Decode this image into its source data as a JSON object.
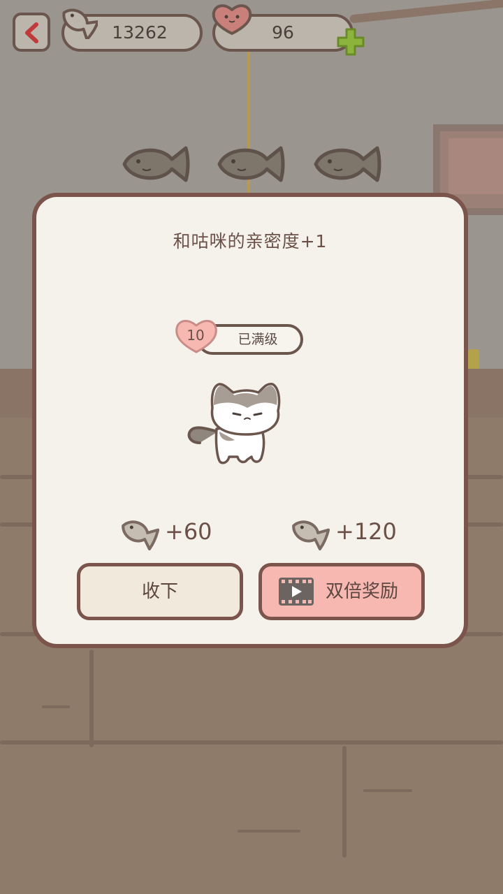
{
  "hud": {
    "fish_count": "13262",
    "heart_count": "96"
  },
  "popup": {
    "title": "和咕咪的亲密度+1",
    "level": "10",
    "level_status": "已满级",
    "reward_normal": "+60",
    "reward_double": "+120",
    "collect_label": "收下",
    "double_label": "双倍奖励"
  },
  "colors": {
    "accent_pink": "#f6b8b1",
    "border_brown": "#7b554c",
    "plus_green": "#8cb43c"
  },
  "icons": [
    "back-arrow-icon",
    "fish-icon",
    "heart-icon",
    "plus-icon",
    "video-icon"
  ]
}
